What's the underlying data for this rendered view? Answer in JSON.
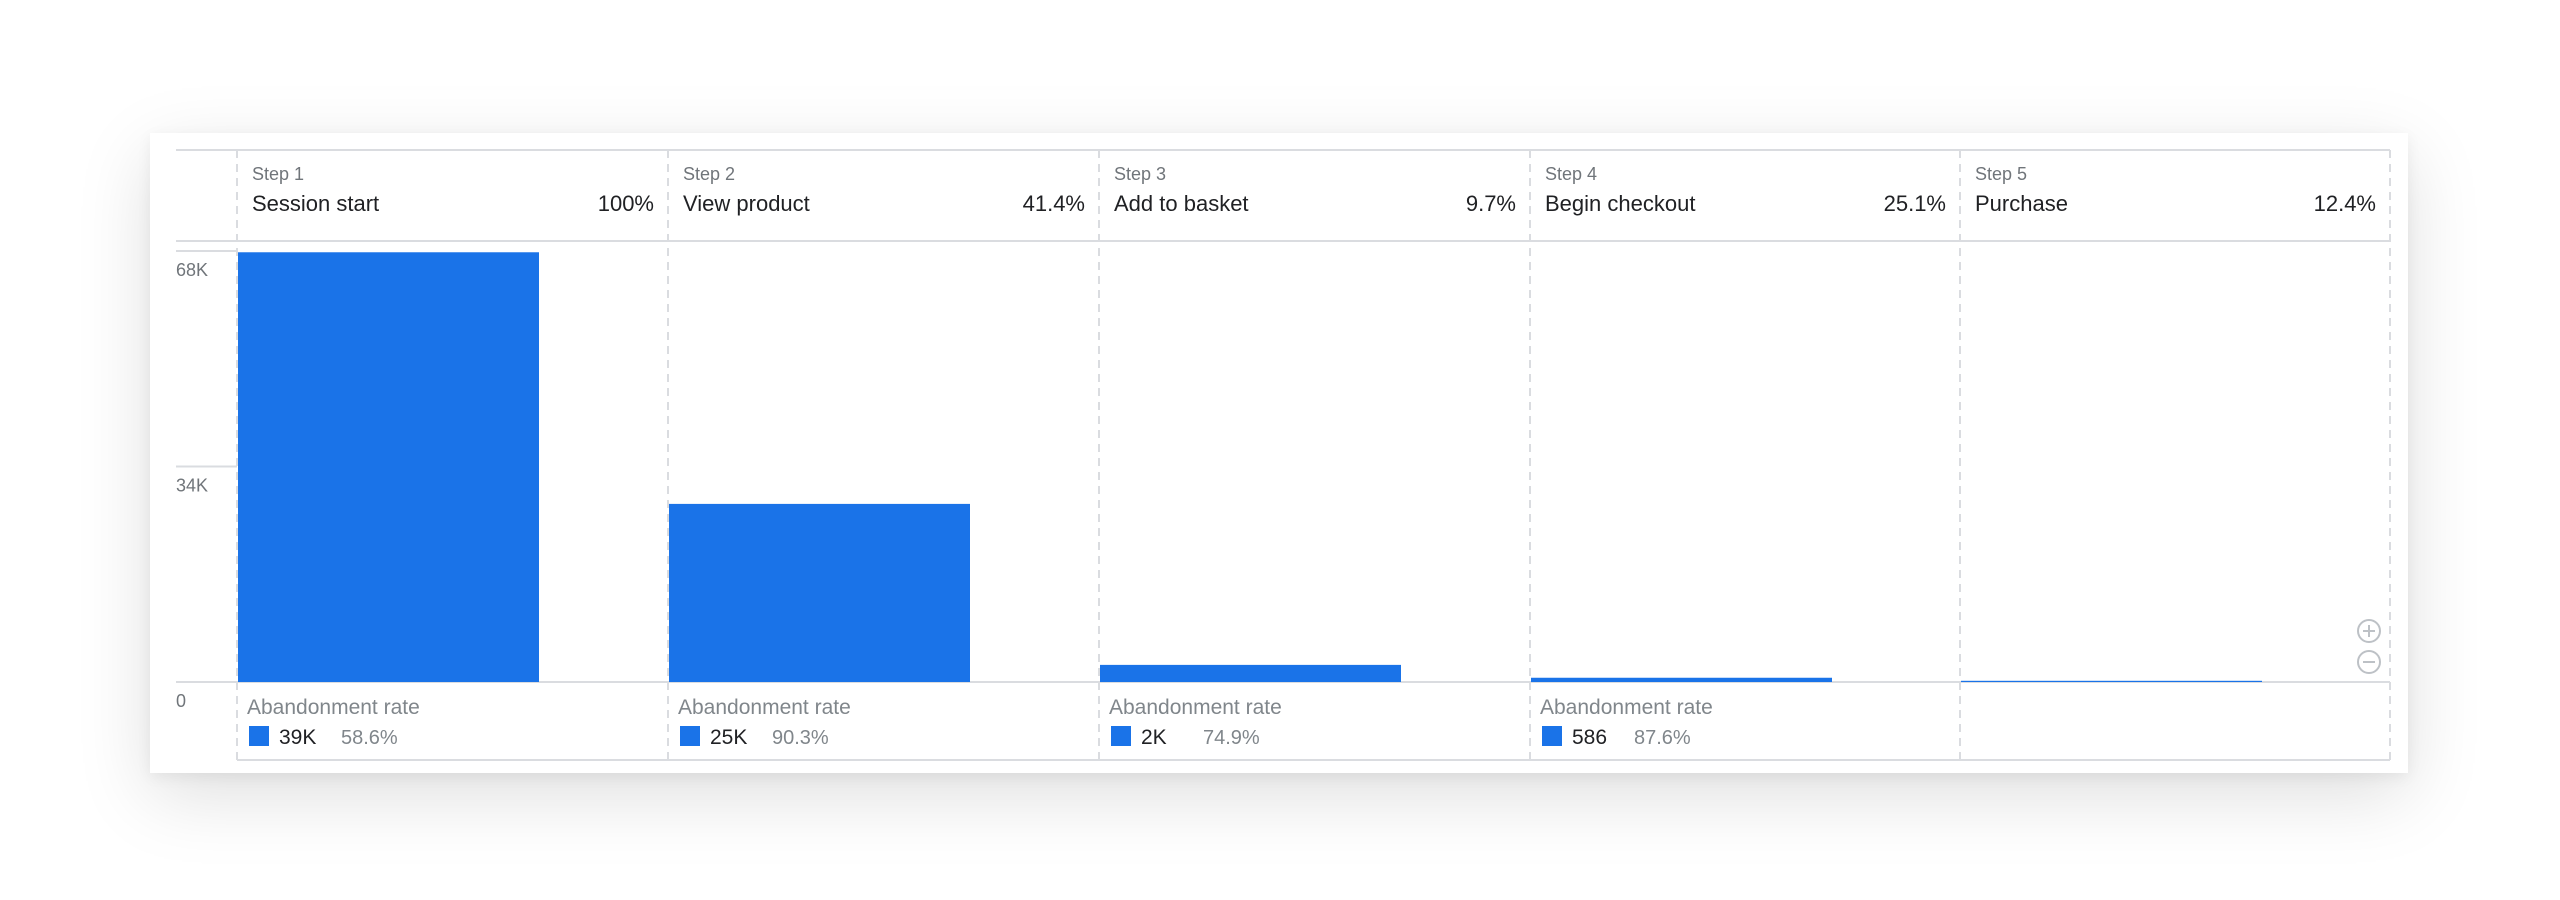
{
  "chart_data": {
    "type": "bar",
    "ylim": [
      0,
      68000
    ],
    "y_ticks": [
      {
        "value": 68000,
        "label": "68K"
      },
      {
        "value": 34000,
        "label": "34K"
      },
      {
        "value": 0,
        "label": "0"
      }
    ],
    "steps": [
      {
        "step_label": "Step 1",
        "name": "Session start",
        "percent": "100%",
        "value": 67800,
        "abandonment": {
          "title": "Abandonment rate",
          "count": "39K",
          "rate": "58.6%"
        }
      },
      {
        "step_label": "Step 2",
        "name": "View product",
        "percent": "41.4%",
        "value": 28100,
        "abandonment": {
          "title": "Abandonment rate",
          "count": "25K",
          "rate": "90.3%"
        }
      },
      {
        "step_label": "Step 3",
        "name": "Add to basket",
        "percent": "9.7%",
        "value": 2700,
        "abandonment": {
          "title": "Abandonment rate",
          "count": "2K",
          "rate": "74.9%"
        }
      },
      {
        "step_label": "Step 4",
        "name": "Begin checkout",
        "percent": "25.1%",
        "value": 670,
        "abandonment": {
          "title": "Abandonment rate",
          "count": "586",
          "rate": "87.6%"
        }
      },
      {
        "step_label": "Step 5",
        "name": "Purchase",
        "percent": "12.4%",
        "value": 84,
        "abandonment": null
      }
    ],
    "bar_color": "#1a73e8",
    "grid": true
  },
  "zoom": {
    "in_icon": "zoom-in-icon",
    "out_icon": "zoom-out-icon"
  }
}
